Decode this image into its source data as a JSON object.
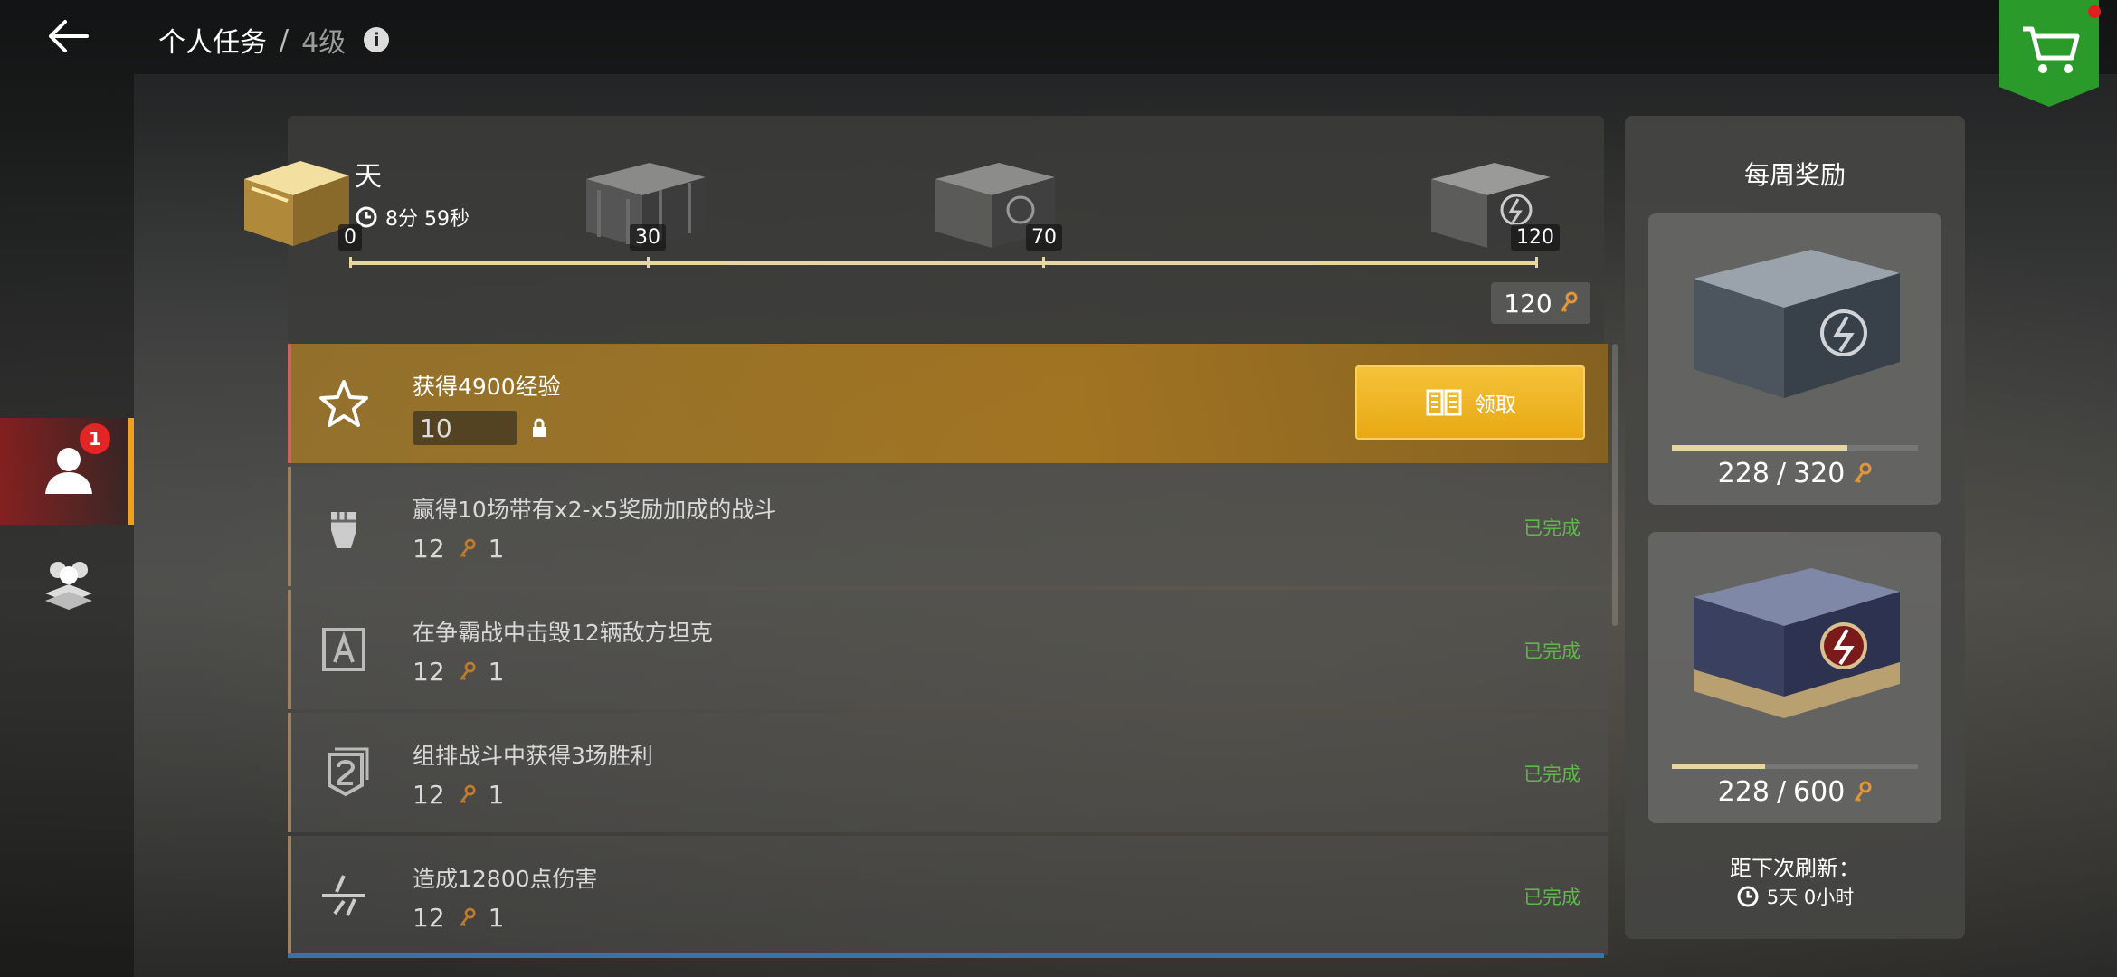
{
  "header": {
    "title": "个人任务",
    "separator": "/",
    "level": "4级"
  },
  "sidebar": {
    "badge_count": "1"
  },
  "progress": {
    "day_label": "天",
    "timer": "8分 59秒",
    "milestones": [
      "0",
      "30",
      "70",
      "120"
    ],
    "total_keys": "120"
  },
  "tasks": [
    {
      "title": "获得4900经验",
      "reward": "10",
      "status": "",
      "icon": "star-icon",
      "claim_label": "领取"
    },
    {
      "title": "赢得10场带有x2-x5奖励加成的战斗",
      "reward": "12",
      "count": "1",
      "status": "已完成",
      "icon": "fist-icon"
    },
    {
      "title": "在争霸战中击毁12辆敌方坦克",
      "reward": "12",
      "count": "1",
      "status": "已完成",
      "icon": "letter-a-icon"
    },
    {
      "title": "组排战斗中获得3场胜利",
      "reward": "12",
      "count": "1",
      "status": "已完成",
      "icon": "platoon-2-icon"
    },
    {
      "title": "造成12800点伤害",
      "reward": "12",
      "count": "1",
      "status": "已完成",
      "icon": "damage-icon"
    }
  ],
  "weekly": {
    "title": "每周奖励",
    "rewards": [
      {
        "current": "228",
        "sep": "/",
        "target": "320",
        "fill": 0.7125
      },
      {
        "current": "228",
        "sep": "/",
        "target": "600",
        "fill": 0.38
      }
    ],
    "refresh_label": "距下次刷新：",
    "refresh_time": "5天 0小时"
  },
  "colors": {
    "accent_gold": "#e8a812",
    "complete_green": "#5fb84a",
    "badge_red": "#e42525",
    "shop_green": "#2a9a2a"
  }
}
